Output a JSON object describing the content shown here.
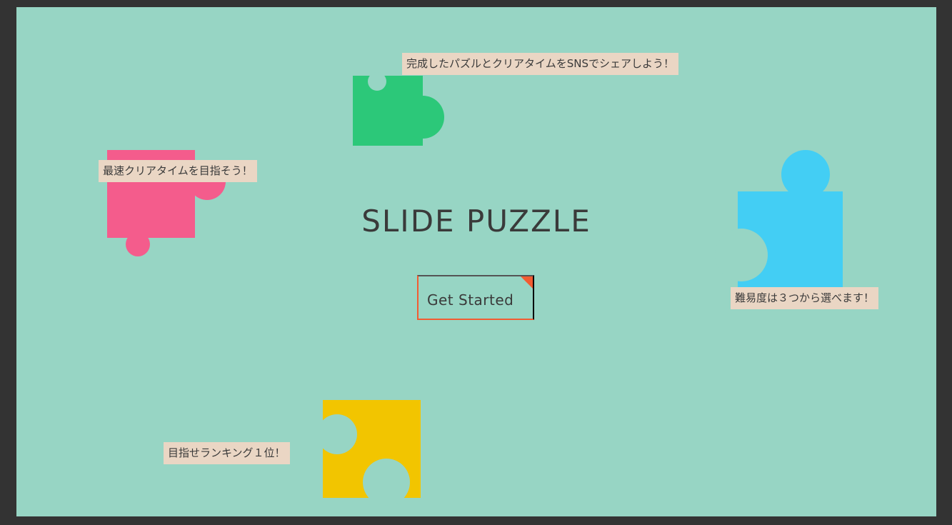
{
  "app": {
    "title": "SLIDE PUZZLE",
    "start_label": "Get Started"
  },
  "callouts": {
    "share": "完成したパズルとクリアタイムをSNSでシェアしよう！",
    "fastest": "最速クリアタイムを目指そう！",
    "difficulty": "難易度は３つから選べます！",
    "ranking": "目指せランキング１位！"
  },
  "colors": {
    "background": "#97d5c4",
    "frame": "#333333",
    "callout_bg": "#ead6c4",
    "accent": "#f25c32",
    "piece_green": "#2cc879",
    "piece_pink": "#f45c8c",
    "piece_blue": "#43cef4",
    "piece_yellow": "#f2c500"
  },
  "icons": {
    "green_piece": "puzzle-piece-icon",
    "pink_piece": "puzzle-piece-icon",
    "blue_piece": "puzzle-piece-icon",
    "yellow_piece": "puzzle-piece-icon",
    "button_corner": "corner-triangle-icon"
  }
}
